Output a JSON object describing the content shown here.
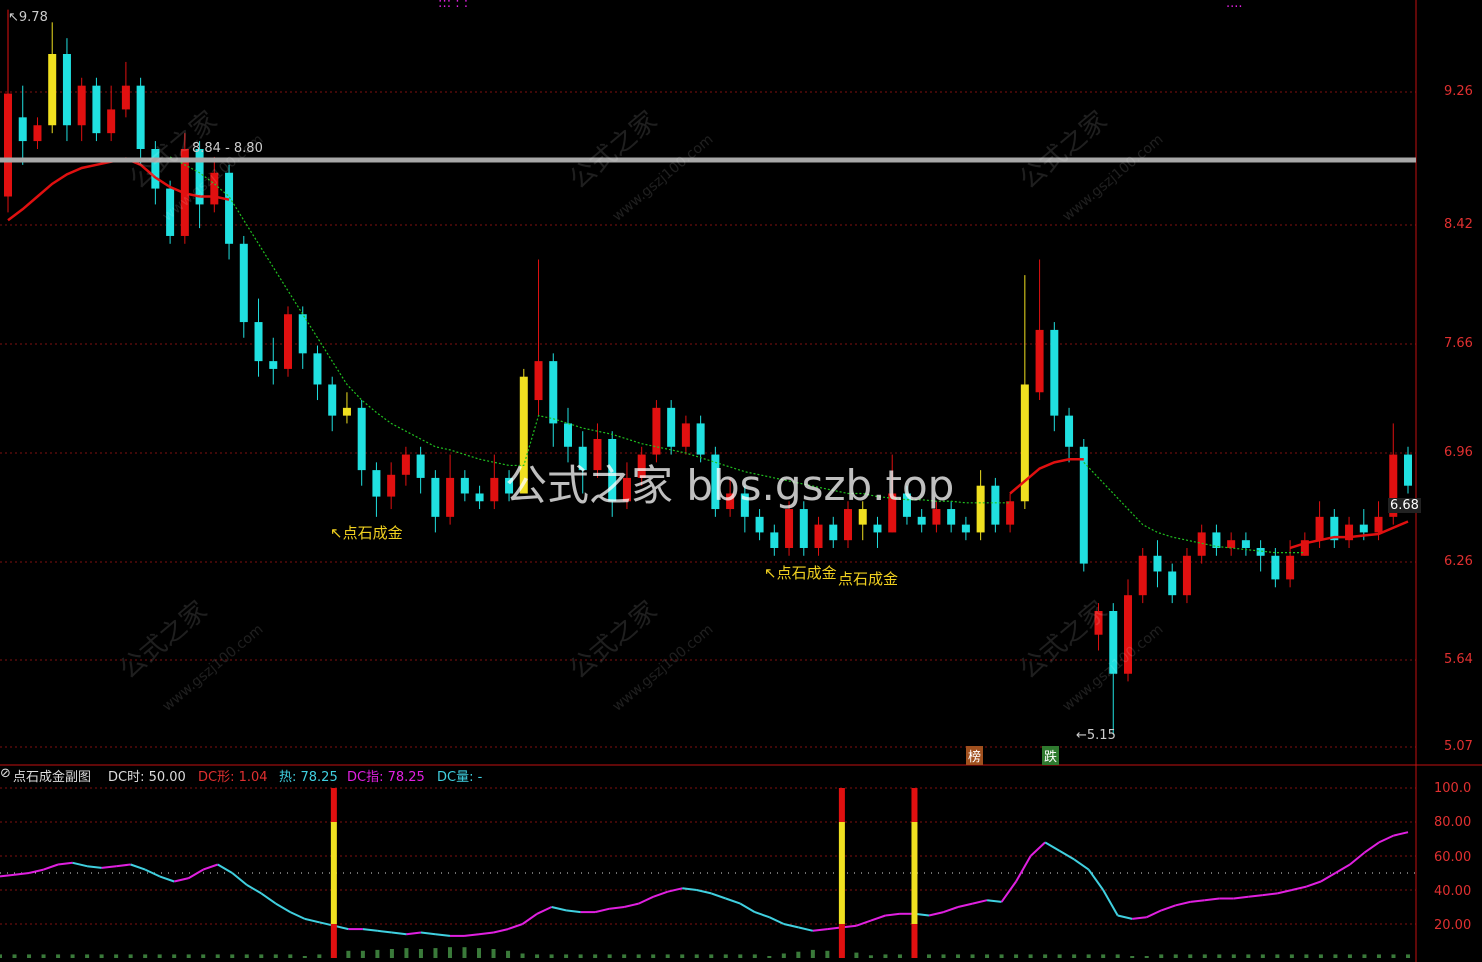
{
  "top_legend": {
    "dots": "::: :   :",
    "tail": "...."
  },
  "main_panel": {
    "y_axis": [
      "9.26",
      "8.42",
      "7.66",
      "6.96",
      "6.26",
      "5.64",
      "5.07"
    ],
    "high_label": "9.78",
    "low_label": "5.15",
    "resistance_label": "8.84 - 8.80",
    "last_price": "6.68",
    "signals": [
      "↖点石成金",
      "↖点石成金",
      "点石成金"
    ],
    "badges": [
      "榜",
      "跌"
    ],
    "watermark": "公式之家 bbs.gszb.top",
    "stamps": [
      "公式之家",
      "www.gszj100.com"
    ]
  },
  "sub_panel": {
    "title": "点石成金副图",
    "dc_time": "DC时: 50.00",
    "dc_shape": "DC形: 1.04",
    "heat": "热: 78.25",
    "dc_index": "DC指: 78.25",
    "dc_volume": "DC量: -",
    "y_axis": [
      "100.0",
      "80.00",
      "60.00",
      "40.00",
      "20.00"
    ]
  },
  "colors": {
    "up": "#e01010",
    "down": "#20e0e0",
    "signal": "#f0e020",
    "ma_red": "#e01010",
    "ma_green": "#20c020",
    "grid": "#801010",
    "magenta": "#e020e0",
    "cyan": "#40d0e0"
  },
  "chart_data": {
    "type": "candlestick",
    "price_axis": [
      5.07,
      9.6
    ],
    "candles": [
      [
        8.6,
        9.25,
        9.78,
        8.5
      ],
      [
        9.1,
        8.95,
        9.3,
        8.8
      ],
      [
        8.95,
        9.05,
        9.1,
        8.9
      ],
      [
        9.05,
        9.5,
        9.7,
        9.0
      ],
      [
        9.5,
        9.05,
        9.6,
        8.95
      ],
      [
        9.05,
        9.3,
        9.35,
        8.95
      ],
      [
        9.3,
        9.0,
        9.35,
        8.95
      ],
      [
        9.0,
        9.15,
        9.3,
        8.95
      ],
      [
        9.15,
        9.3,
        9.45,
        9.1
      ],
      [
        9.3,
        8.9,
        9.35,
        8.8
      ],
      [
        8.9,
        8.65,
        8.95,
        8.55
      ],
      [
        8.65,
        8.35,
        8.7,
        8.3
      ],
      [
        8.35,
        8.9,
        9.0,
        8.3
      ],
      [
        8.9,
        8.55,
        8.95,
        8.4
      ],
      [
        8.55,
        8.75,
        8.85,
        8.5
      ],
      [
        8.75,
        8.3,
        8.8,
        8.2
      ],
      [
        8.3,
        7.8,
        8.35,
        7.7
      ],
      [
        7.8,
        7.55,
        7.95,
        7.45
      ],
      [
        7.55,
        7.5,
        7.7,
        7.4
      ],
      [
        7.5,
        7.85,
        7.9,
        7.45
      ],
      [
        7.85,
        7.6,
        7.9,
        7.5
      ],
      [
        7.6,
        7.4,
        7.65,
        7.3
      ],
      [
        7.4,
        7.2,
        7.45,
        7.1
      ],
      [
        7.2,
        7.25,
        7.35,
        7.15
      ],
      [
        7.25,
        6.85,
        7.3,
        6.75
      ],
      [
        6.85,
        6.68,
        6.9,
        6.55
      ],
      [
        6.68,
        6.82,
        6.9,
        6.6
      ],
      [
        6.82,
        6.95,
        7.0,
        6.75
      ],
      [
        6.95,
        6.8,
        7.0,
        6.7
      ],
      [
        6.8,
        6.55,
        6.85,
        6.45
      ],
      [
        6.55,
        6.8,
        6.95,
        6.5
      ],
      [
        6.8,
        6.7,
        6.85,
        6.65
      ],
      [
        6.7,
        6.65,
        6.75,
        6.6
      ],
      [
        6.65,
        6.8,
        6.95,
        6.6
      ],
      [
        6.8,
        6.7,
        6.85,
        6.65
      ],
      [
        6.7,
        7.45,
        7.5,
        6.7
      ],
      [
        7.3,
        7.55,
        8.2,
        7.2
      ],
      [
        7.55,
        7.15,
        7.6,
        7.0
      ],
      [
        7.15,
        7.0,
        7.25,
        6.9
      ],
      [
        7.0,
        6.85,
        7.1,
        6.7
      ],
      [
        6.85,
        7.05,
        7.15,
        6.8
      ],
      [
        7.05,
        6.65,
        7.1,
        6.55
      ],
      [
        6.65,
        6.8,
        6.9,
        6.6
      ],
      [
        6.8,
        6.95,
        7.0,
        6.75
      ],
      [
        6.95,
        7.25,
        7.3,
        6.9
      ],
      [
        7.25,
        7.0,
        7.3,
        6.95
      ],
      [
        7.0,
        7.15,
        7.2,
        6.95
      ],
      [
        7.15,
        6.95,
        7.2,
        6.9
      ],
      [
        6.95,
        6.6,
        7.0,
        6.55
      ],
      [
        6.6,
        6.7,
        6.8,
        6.55
      ],
      [
        6.7,
        6.55,
        6.75,
        6.45
      ],
      [
        6.55,
        6.45,
        6.6,
        6.4
      ],
      [
        6.45,
        6.35,
        6.5,
        6.3
      ],
      [
        6.35,
        6.6,
        6.65,
        6.3
      ],
      [
        6.6,
        6.35,
        6.65,
        6.3
      ],
      [
        6.35,
        6.5,
        6.55,
        6.3
      ],
      [
        6.5,
        6.4,
        6.55,
        6.35
      ],
      [
        6.4,
        6.6,
        6.65,
        6.35
      ],
      [
        6.6,
        6.5,
        6.65,
        6.4
      ],
      [
        6.5,
        6.45,
        6.55,
        6.35
      ],
      [
        6.45,
        6.7,
        6.95,
        6.45
      ],
      [
        6.7,
        6.55,
        6.75,
        6.5
      ],
      [
        6.55,
        6.5,
        6.6,
        6.45
      ],
      [
        6.5,
        6.6,
        6.65,
        6.45
      ],
      [
        6.6,
        6.5,
        6.65,
        6.45
      ],
      [
        6.5,
        6.45,
        6.55,
        6.4
      ],
      [
        6.45,
        6.75,
        6.85,
        6.4
      ],
      [
        6.75,
        6.5,
        6.8,
        6.45
      ],
      [
        6.5,
        6.65,
        6.7,
        6.45
      ],
      [
        6.65,
        7.4,
        8.1,
        6.6
      ],
      [
        7.35,
        7.75,
        8.2,
        7.3
      ],
      [
        7.75,
        7.2,
        7.8,
        7.1
      ],
      [
        7.2,
        7.0,
        7.25,
        6.9
      ],
      [
        7.0,
        6.25,
        7.05,
        6.2
      ],
      [
        5.8,
        5.95,
        6.0,
        5.7
      ],
      [
        5.95,
        5.55,
        6.0,
        5.15
      ],
      [
        5.55,
        6.05,
        6.15,
        5.5
      ],
      [
        6.05,
        6.3,
        6.35,
        6.0
      ],
      [
        6.3,
        6.2,
        6.4,
        6.1
      ],
      [
        6.2,
        6.05,
        6.25,
        6.0
      ],
      [
        6.05,
        6.3,
        6.35,
        6.0
      ],
      [
        6.3,
        6.45,
        6.5,
        6.25
      ],
      [
        6.45,
        6.35,
        6.5,
        6.3
      ],
      [
        6.35,
        6.4,
        6.45,
        6.3
      ],
      [
        6.4,
        6.35,
        6.45,
        6.3
      ],
      [
        6.35,
        6.3,
        6.4,
        6.2
      ],
      [
        6.3,
        6.15,
        6.35,
        6.1
      ],
      [
        6.15,
        6.3,
        6.4,
        6.1
      ],
      [
        6.3,
        6.4,
        6.45,
        6.3
      ],
      [
        6.4,
        6.55,
        6.65,
        6.35
      ],
      [
        6.55,
        6.4,
        6.6,
        6.35
      ],
      [
        6.4,
        6.5,
        6.55,
        6.35
      ],
      [
        6.5,
        6.45,
        6.6,
        6.4
      ],
      [
        6.45,
        6.55,
        6.65,
        6.4
      ],
      [
        6.55,
        6.95,
        7.15,
        6.5
      ],
      [
        6.95,
        6.75,
        7.0,
        6.7
      ]
    ],
    "signal_candles": [
      3,
      23,
      35,
      58,
      66,
      69
    ],
    "ma_red": [
      8.45,
      8.52,
      8.6,
      8.68,
      8.74,
      8.78,
      8.8,
      8.82,
      8.84,
      8.8,
      8.72,
      8.66,
      8.62,
      8.6,
      8.6,
      8.58,
      null,
      null,
      null,
      null,
      null,
      null,
      null,
      null,
      null,
      null,
      null,
      null,
      null,
      null,
      null,
      null,
      null,
      null,
      null,
      null,
      null,
      null,
      null,
      null,
      null,
      null,
      null,
      null,
      null,
      null,
      null,
      null,
      null,
      null,
      null,
      null,
      null,
      null,
      null,
      null,
      null,
      null,
      null,
      null,
      null,
      null,
      null,
      null,
      null,
      null,
      null,
      null,
      6.7,
      6.78,
      6.86,
      6.9,
      6.92,
      6.92,
      null,
      null,
      null,
      null,
      null,
      null,
      null,
      null,
      null,
      null,
      null,
      null,
      null,
      6.35,
      6.38,
      6.4,
      6.42,
      6.42,
      6.43,
      6.44,
      6.48,
      6.52
    ],
    "ma_green": [
      null,
      null,
      null,
      null,
      null,
      null,
      null,
      null,
      null,
      null,
      null,
      8.85,
      8.8,
      8.75,
      8.68,
      8.6,
      8.45,
      8.3,
      8.15,
      8.0,
      7.85,
      7.7,
      7.55,
      7.4,
      7.3,
      7.22,
      7.15,
      7.1,
      7.05,
      7.0,
      6.98,
      6.95,
      6.92,
      6.9,
      6.88,
      6.88,
      7.2,
      7.18,
      7.15,
      7.12,
      7.1,
      7.08,
      7.05,
      7.02,
      7.0,
      6.98,
      6.96,
      6.93,
      6.9,
      6.87,
      6.84,
      6.82,
      6.8,
      6.78,
      6.76,
      6.74,
      6.72,
      6.7,
      6.7,
      6.68,
      6.67,
      6.66,
      6.66,
      6.65,
      6.65,
      6.64,
      6.64,
      6.64,
      6.64,
      null,
      null,
      null,
      null,
      6.9,
      6.8,
      6.7,
      6.6,
      6.5,
      6.45,
      6.42,
      6.4,
      6.38,
      6.36,
      6.35,
      6.34,
      6.33,
      6.32,
      6.32,
      6.32,
      null,
      null,
      null,
      null,
      null,
      null,
      null
    ],
    "sub_series": [
      48,
      49,
      50,
      52,
      55,
      56,
      54,
      53,
      54,
      55,
      52,
      48,
      45,
      47,
      52,
      55,
      50,
      43,
      38,
      32,
      27,
      23,
      21,
      19,
      17,
      17,
      16,
      15,
      14,
      15,
      14,
      13,
      13,
      14,
      15,
      17,
      20,
      26,
      30,
      28,
      27,
      27,
      29,
      30,
      32,
      36,
      39,
      41,
      40,
      38,
      35,
      32,
      27,
      24,
      20,
      18,
      16,
      17,
      18,
      19,
      22,
      25,
      26,
      26,
      25,
      27,
      30,
      32,
      34,
      33,
      45,
      60,
      68,
      63,
      58,
      52,
      40,
      25,
      23,
      24,
      28,
      31,
      33,
      34,
      35,
      35,
      36,
      37,
      38,
      40,
      42,
      45,
      50,
      55,
      62,
      68,
      72,
      74
    ],
    "sub_signals": [
      {
        "index": 23,
        "value": 100
      },
      {
        "index": 58,
        "value": 100
      },
      {
        "index": 63,
        "value": 100
      }
    ],
    "sub_ylim": [
      0,
      100
    ],
    "dotted_reference": 50
  }
}
